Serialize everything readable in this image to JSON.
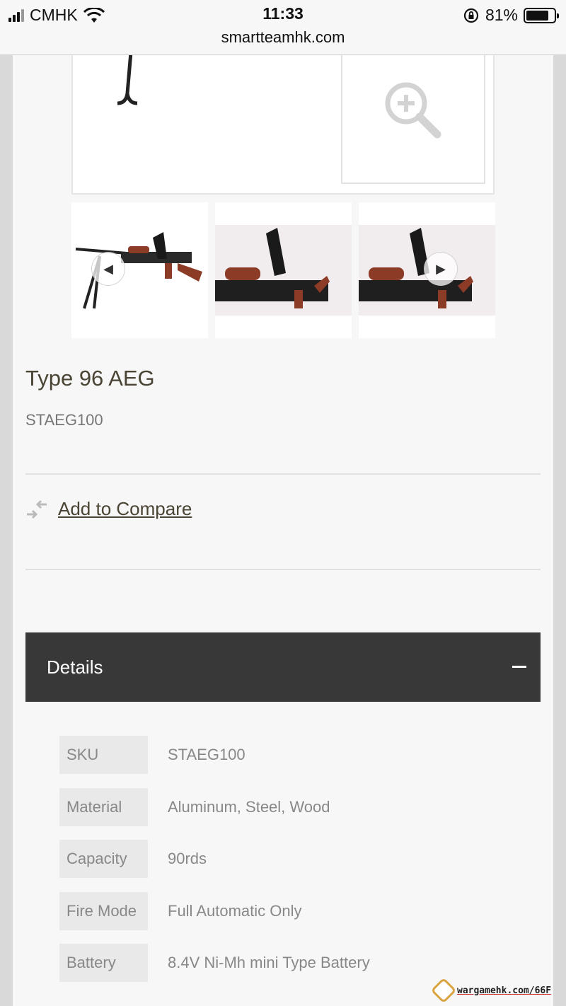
{
  "status_bar": {
    "carrier": "CMHK",
    "time": "11:33",
    "url": "smartteamhk.com",
    "battery_percent": "81%",
    "battery_level": 0.81
  },
  "gallery": {
    "main_image_icon": "zoom-in-icon",
    "thumbnails": [
      {
        "name": "thumbnail-1",
        "nav": "prev"
      },
      {
        "name": "thumbnail-2",
        "nav": null
      },
      {
        "name": "thumbnail-3",
        "nav": "next"
      }
    ]
  },
  "product": {
    "title": "Type 96 AEG",
    "sku": "STAEG100",
    "compare_label": "Add to Compare"
  },
  "details": {
    "header": "Details",
    "rows": [
      {
        "key": "SKU",
        "value": "STAEG100"
      },
      {
        "key": "Material",
        "value": "Aluminum, Steel, Wood"
      },
      {
        "key": "Capacity",
        "value": "90rds"
      },
      {
        "key": "Fire Mode",
        "value": "Full Automatic Only"
      },
      {
        "key": "Battery",
        "value": "8.4V Ni-Mh mini Type Battery"
      }
    ]
  },
  "watermark": {
    "text": "wargamehk.com/66F"
  },
  "colors": {
    "page_bg": "#f7f7f7",
    "details_bar": "#383838",
    "title_text": "#4a4435",
    "muted_text": "#888888",
    "wood": "#8b3b26"
  }
}
